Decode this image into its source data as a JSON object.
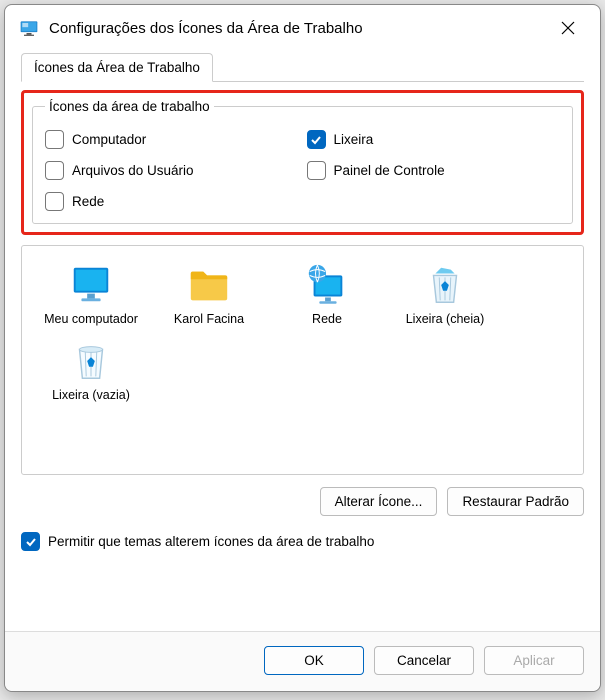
{
  "title": "Configurações dos Ícones da Área de Trabalho",
  "tab_label": "Ícones da Área de Trabalho",
  "group_legend": "Ícones da área de trabalho",
  "checkboxes": {
    "computer": {
      "label": "Computador",
      "checked": false
    },
    "recyclebin": {
      "label": "Lixeira",
      "checked": true
    },
    "userfiles": {
      "label": "Arquivos do Usuário",
      "checked": false
    },
    "controlpanel": {
      "label": "Painel de Controle",
      "checked": false
    },
    "network": {
      "label": "Rede",
      "checked": false
    }
  },
  "icons": [
    {
      "name": "my-computer",
      "label": "Meu computador",
      "selected": false
    },
    {
      "name": "user-folder",
      "label": "Karol Facina",
      "selected": false
    },
    {
      "name": "network",
      "label": "Rede",
      "selected": false
    },
    {
      "name": "recycle-full",
      "label": "Lixeira (cheia)",
      "selected": false
    },
    {
      "name": "recycle-empty",
      "label": "Lixeira (vazia)",
      "selected": false
    }
  ],
  "buttons": {
    "change_icon": "Alterar Ícone...",
    "restore_default": "Restaurar Padrão"
  },
  "themes_checkbox": {
    "label": "Permitir que temas alterem ícones da área de trabalho",
    "checked": true
  },
  "footer": {
    "ok": "OK",
    "cancel": "Cancelar",
    "apply": "Aplicar"
  }
}
